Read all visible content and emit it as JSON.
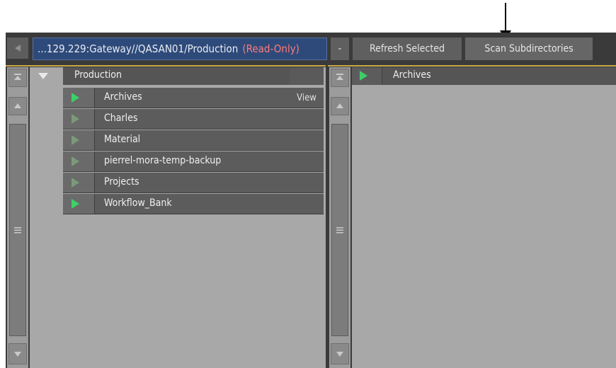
{
  "toolbar": {
    "path_text": "...129.229:Gateway//QASAN01/Production",
    "read_only": "(Read-Only)",
    "minus_label": "-",
    "refresh_label": "Refresh Selected",
    "scan_label": "Scan Subdirectories"
  },
  "tree": {
    "root_label": "Production",
    "items": [
      {
        "label": "Archives",
        "action": "View",
        "expander": "bright"
      },
      {
        "label": "Charles",
        "action": "",
        "expander": "dim"
      },
      {
        "label": "Material",
        "action": "",
        "expander": "dim"
      },
      {
        "label": "pierrel-mora-temp-backup",
        "action": "",
        "expander": "dim"
      },
      {
        "label": "Projects",
        "action": "",
        "expander": "dim"
      },
      {
        "label": "Workflow_Bank",
        "action": "",
        "expander": "bright"
      }
    ]
  },
  "right_pane": {
    "header_label": "Archives"
  },
  "colors": {
    "path_field_bg": "#2e4a7a",
    "read_only_text": "#ff7b7b",
    "accent_line": "#c8a94a",
    "expander_active": "#3ed068"
  },
  "icons": {
    "back": "left-arrow-icon",
    "collapse": "triangle-down-icon",
    "expand": "triangle-right-icon",
    "scroll_top": "scroll-to-top-icon",
    "scroll_up": "arrow-up-icon",
    "scroll_down": "arrow-down-icon",
    "grip": "grip-icon"
  }
}
